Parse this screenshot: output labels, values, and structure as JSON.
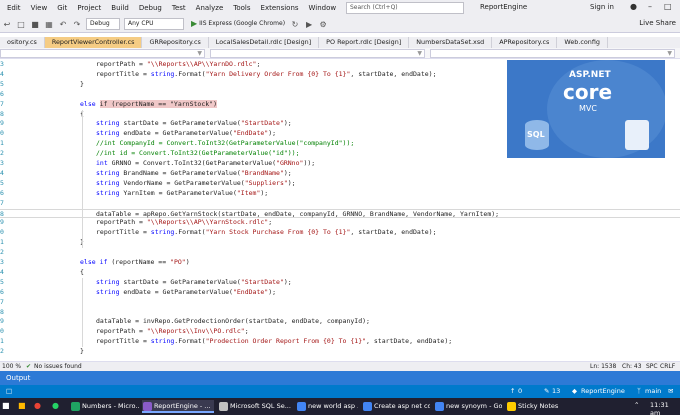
{
  "menubar": {
    "items": [
      "Edit",
      "View",
      "Git",
      "Project",
      "Build",
      "Debug",
      "Test",
      "Analyze",
      "Tools",
      "Extensions",
      "Window",
      "Help"
    ],
    "search_placeholder": "Search (Ctrl+Q)",
    "app_name": "ReportEngine",
    "signin": "Sign in"
  },
  "toolbar": {
    "config": "Debug",
    "platform": "Any CPU",
    "run_label": "IIS Express (Google Chrome)",
    "liveshare": "Live Share"
  },
  "tabs": [
    {
      "label": "ository.cs"
    },
    {
      "label": "ReportViewerController.cs"
    },
    {
      "label": "GRRepository.cs"
    },
    {
      "label": "LocalSalesDetail.rdlc [Design]"
    },
    {
      "label": "PO Report.rdlc [Design]"
    },
    {
      "label": "NumbersDataSet.xsd"
    },
    {
      "label": "APRepository.cs"
    },
    {
      "label": "Web.config"
    }
  ],
  "editor": {
    "lines": [
      {
        "n": "3",
        "code": [
          [
            "",
            "reportPath = "
          ],
          [
            "st",
            "\"\\\\Reports\\\\AP\\\\YarnDO.rdlc\""
          ],
          [
            "",
            ";"
          ]
        ]
      },
      {
        "n": "4",
        "code": [
          [
            "",
            "reportTitle = "
          ],
          [
            "kw",
            "string"
          ],
          [
            "",
            ".Format("
          ],
          [
            "st",
            "\"Yarn Delivery Order From {0} To {1}\""
          ],
          [
            "",
            ", startDate, endDate);"
          ]
        ]
      },
      {
        "n": "5",
        "code": [
          [
            "",
            "}"
          ]
        ],
        "indent": 0
      },
      {
        "n": "6",
        "code": [],
        "indent": 0
      },
      {
        "n": "7",
        "code": [
          [
            "kw",
            "else "
          ],
          [
            "hl",
            "if (reportName == \"YarnStock\")"
          ]
        ],
        "indent": 0
      },
      {
        "n": "8",
        "code": [
          [
            "",
            "{"
          ]
        ],
        "indent": 0
      },
      {
        "n": "9",
        "code": [
          [
            "kw",
            "string"
          ],
          [
            "",
            " startDate = GetParameterValue("
          ],
          [
            "st",
            "\"StartDate\""
          ],
          [
            "",
            ");"
          ]
        ]
      },
      {
        "n": "0",
        "code": [
          [
            "kw",
            "string"
          ],
          [
            "",
            " endDate = GetParameterValue("
          ],
          [
            "st",
            "\"EndDate\""
          ],
          [
            "",
            ");"
          ]
        ]
      },
      {
        "n": "1",
        "code": [
          [
            "cm",
            "//int CompanyId = Convert.ToInt32(GetParameterValue(\"companyId\"));"
          ]
        ]
      },
      {
        "n": "2",
        "code": [
          [
            "cm",
            "//int id = Convert.ToInt32(GetParameterValue(\"id\"));"
          ]
        ]
      },
      {
        "n": "3",
        "code": [
          [
            "kw",
            "int"
          ],
          [
            "",
            " GRNNO = Convert.ToInt32(GetParameterValue("
          ],
          [
            "st",
            "\"GRNno\""
          ],
          [
            "",
            "));"
          ]
        ]
      },
      {
        "n": "4",
        "code": [
          [
            "kw",
            "string"
          ],
          [
            "",
            " BrandName = GetParameterValue("
          ],
          [
            "st",
            "\"BrandName\""
          ],
          [
            "",
            ");"
          ]
        ]
      },
      {
        "n": "5",
        "code": [
          [
            "kw",
            "string"
          ],
          [
            "",
            " VendorName = GetParameterValue("
          ],
          [
            "st",
            "\"Suppliers\""
          ],
          [
            "",
            ");"
          ]
        ]
      },
      {
        "n": "6",
        "code": [
          [
            "kw",
            "string"
          ],
          [
            "",
            " YarnItem = GetParameterValue("
          ],
          [
            "st",
            "\"Item\""
          ],
          [
            "",
            ");"
          ]
        ]
      },
      {
        "n": "7",
        "code": []
      },
      {
        "n": "8",
        "code": [
          [
            "",
            "dataTable = apRepo.GetYarnStock(startDate, endDate, companyId, GRNNO, BrandName, VendorName, YarnItem);"
          ]
        ],
        "current": true
      },
      {
        "n": "9",
        "code": [
          [
            "",
            "reportPath = "
          ],
          [
            "st",
            "\"\\\\Reports\\\\AP\\\\YarnStock.rdlc\""
          ],
          [
            "",
            ";"
          ]
        ]
      },
      {
        "n": "0",
        "code": [
          [
            "",
            "reportTitle = "
          ],
          [
            "kw",
            "string"
          ],
          [
            "",
            ".Format("
          ],
          [
            "st",
            "\"Yarn Stock Purchase From {0} To {1}\""
          ],
          [
            "",
            ", startDate, endDate);"
          ]
        ]
      },
      {
        "n": "1",
        "code": [
          [
            "",
            "}"
          ]
        ],
        "indent": 0
      },
      {
        "n": "2",
        "code": [],
        "indent": 0
      },
      {
        "n": "3",
        "code": [
          [
            "kw",
            "else if"
          ],
          [
            "",
            " (reportName == "
          ],
          [
            "st",
            "\"PO\""
          ],
          [
            "",
            ")"
          ]
        ],
        "indent": 0
      },
      {
        "n": "4",
        "code": [
          [
            "",
            "{"
          ]
        ],
        "indent": 0
      },
      {
        "n": "5",
        "code": [
          [
            "kw",
            "string"
          ],
          [
            "",
            " startDate = GetParameterValue("
          ],
          [
            "st",
            "\"StartDate\""
          ],
          [
            "",
            ");"
          ]
        ]
      },
      {
        "n": "6",
        "code": [
          [
            "kw",
            "string"
          ],
          [
            "",
            " endDate = GetParameterValue("
          ],
          [
            "st",
            "\"EndDate\""
          ],
          [
            "",
            ");"
          ]
        ]
      },
      {
        "n": "7",
        "code": []
      },
      {
        "n": "8",
        "code": []
      },
      {
        "n": "9",
        "code": [
          [
            "",
            "dataTable = invRepo.GetProdectionOrder(startDate, endDate, companyId);"
          ]
        ]
      },
      {
        "n": "0",
        "code": [
          [
            "",
            "reportPath = "
          ],
          [
            "st",
            "\"\\\\Reports\\\\Inv\\\\PO.rdlc\""
          ],
          [
            "",
            ";"
          ]
        ]
      },
      {
        "n": "1",
        "code": [
          [
            "",
            "reportTitle = "
          ],
          [
            "kw",
            "string"
          ],
          [
            "",
            ".Format("
          ],
          [
            "st",
            "\"Prodection Order Report From {0} To {1}\""
          ],
          [
            "",
            ", startDate, endDate);"
          ]
        ]
      },
      {
        "n": "2",
        "code": [
          [
            "",
            "}"
          ]
        ],
        "indent": 0
      }
    ]
  },
  "promo": {
    "aspnet": "ASP.NET",
    "core": "core",
    "mvc": "MVC",
    "sql": "SQL"
  },
  "statusline": {
    "zoom": "100 %",
    "issues": "No issues found",
    "ln": "Ln: 1538",
    "ch": "Ch: 43",
    "spc": "SPC",
    "crlf": "CRLF"
  },
  "output": {
    "label": "Output"
  },
  "vs_status": {
    "errors": "0",
    "changes": "13",
    "repo": "ReportEngine",
    "branch": "main"
  },
  "taskbar": {
    "apps": [
      "Numbers - Micro...",
      "ReportEngine - ...",
      "Microsoft SQL Se...",
      "new world asp .n...",
      "Create asp net co...",
      "new synoym - Go...",
      "Sticky Notes"
    ],
    "clock": "11:31 am"
  }
}
